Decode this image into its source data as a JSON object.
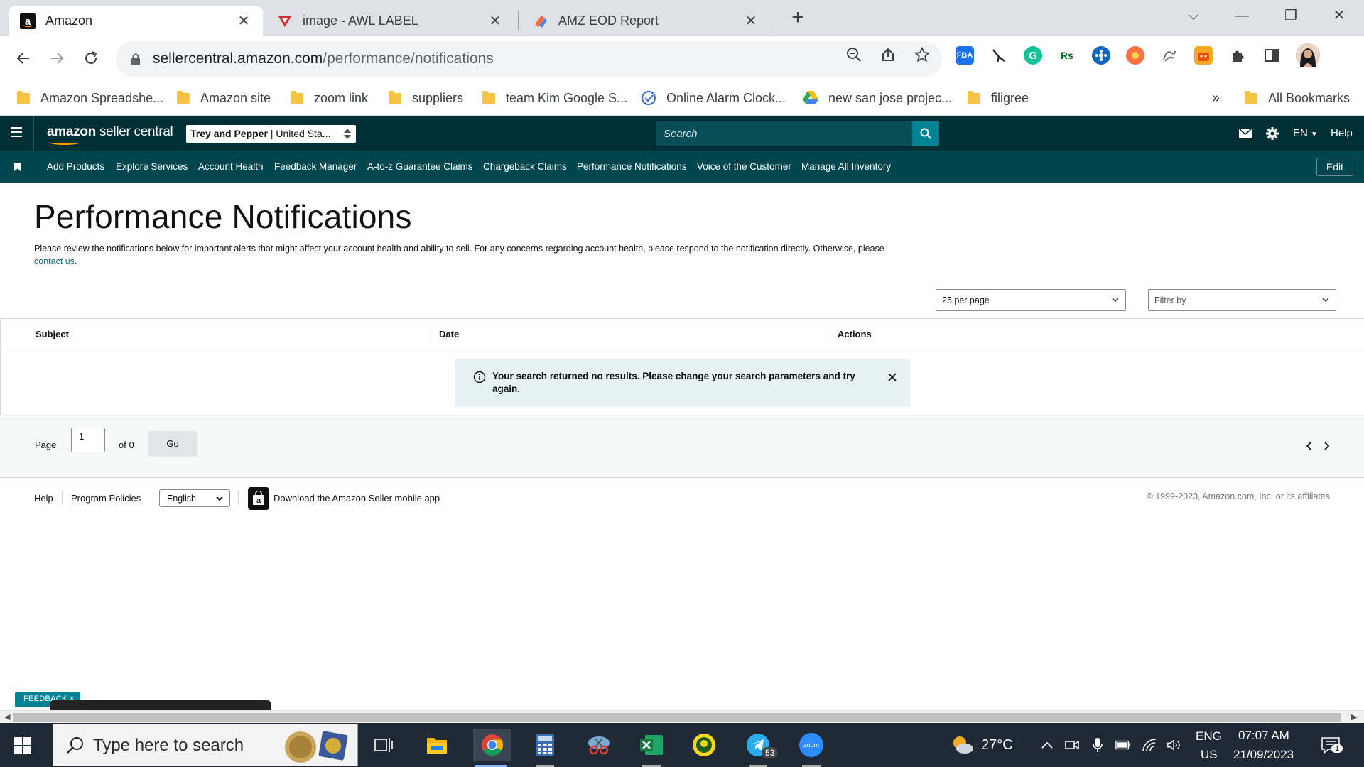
{
  "browser": {
    "tabs": [
      {
        "title": "Amazon",
        "active": true
      },
      {
        "title": "image - AWL LABEL",
        "active": false
      },
      {
        "title": "AMZ EOD Report",
        "active": false
      }
    ],
    "url_host": "sellercentral.amazon.com",
    "url_path": "/performance/notifications",
    "extensions": [
      "FBA",
      "Rs"
    ],
    "bookmarks": [
      "Amazon Spreadshe...",
      "Amazon site",
      "zoom link",
      "suppliers",
      "team Kim Google S...",
      "Online Alarm Clock...",
      "new san jose projec...",
      "filigree"
    ],
    "bookmarks_overflow": "»",
    "all_bookmarks": "All Bookmarks"
  },
  "seller": {
    "logo_bold": "amazon",
    "logo_rest": " seller central",
    "store_name": "Trey and Pepper",
    "store_region": "United Sta...",
    "search_placeholder": "Search",
    "language": "EN",
    "help": "Help",
    "nav": [
      "Add Products",
      "Explore Services",
      "Account Health",
      "Feedback Manager",
      "A-to-z Guarantee Claims",
      "Chargeback Claims",
      "Performance Notifications",
      "Voice of the Customer",
      "Manage All Inventory"
    ],
    "edit": "Edit"
  },
  "main": {
    "title": "Performance Notifications",
    "intro_text": "Please review the notifications below for important alerts that might affect your account health and ability to sell. For any concerns regarding account health, please respond to the notification directly. Otherwise, please ",
    "intro_link": "contact us",
    "intro_end": ".",
    "per_page": "25 per page",
    "filter": "Filter by",
    "columns": [
      "Subject",
      "Date",
      "Actions"
    ],
    "alert": "Your search returned no results. Please change your search parameters and try again.",
    "page_label": "Page",
    "page_value": "1",
    "page_of": "of 0",
    "go": "Go"
  },
  "footer": {
    "help": "Help",
    "policies": "Program Policies",
    "language": "English",
    "app_link": "Download the Amazon Seller mobile app",
    "copyright": "© 1999-2023, Amazon.com, Inc. or its affiliates"
  },
  "overlay": {
    "feedback": "FEEDBACK ×"
  },
  "taskbar": {
    "search_placeholder": "Type here to search",
    "telegram_badge": "53",
    "weather": "27°C",
    "lang_top": "ENG",
    "lang_bottom": "US",
    "time": "07:07 AM",
    "date": "21/09/2023",
    "notif_count": "1"
  },
  "colors": {
    "header": "#002f36",
    "nav": "#00464f",
    "link": "#007185",
    "alert_bg": "#e6f2f4"
  }
}
